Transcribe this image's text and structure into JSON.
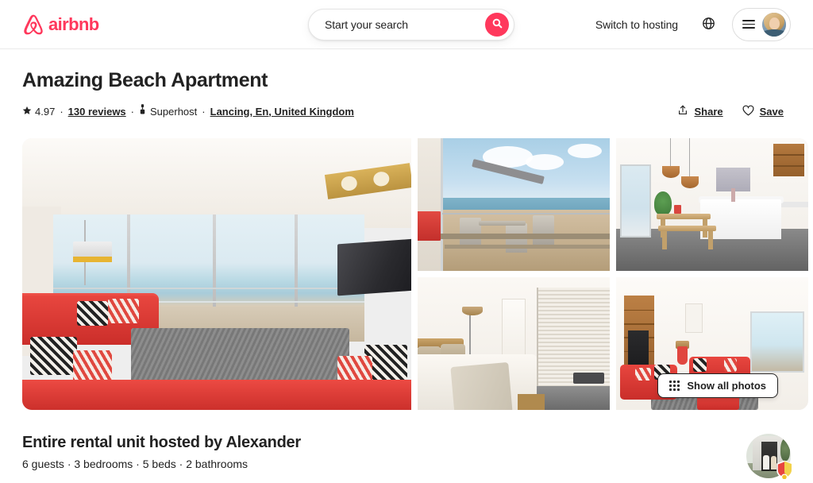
{
  "header": {
    "logo_text": "airbnb",
    "logo_icon": "airbnb-bird-logo",
    "search_placeholder": "Start your search",
    "search_icon": "search-icon",
    "switch_to_hosting": "Switch to hosting",
    "globe_icon": "globe-icon",
    "menu_icon": "hamburger-menu-icon",
    "avatar_icon": "user-avatar"
  },
  "listing": {
    "title": "Amazing Beach Apartment",
    "star_icon": "star-icon",
    "rating": "4.97",
    "separator": "·",
    "reviews": "130 reviews",
    "superhost_icon": "superhost-badge-icon",
    "superhost": "Superhost",
    "location": "Lancing, En, United Kingdom",
    "share_icon": "share-upload-icon",
    "share_label": "Share",
    "save_icon": "heart-icon",
    "save_label": "Save"
  },
  "gallery": {
    "show_all_label": "Show all photos",
    "show_all_icon": "grid-dots-icon",
    "photos": [
      {
        "name": "living-room-sea-view"
      },
      {
        "name": "balcony-beach-view"
      },
      {
        "name": "dining-kitchen"
      },
      {
        "name": "bedroom"
      },
      {
        "name": "lounge-red-sofas"
      }
    ]
  },
  "host_section": {
    "title": "Entire rental unit hosted by Alexander",
    "details": "6 guests · 3 bedrooms · 5 beds · 2 bathrooms",
    "avatar_icon": "host-avatar",
    "superhost_badge_icon": "superhost-shield-badge"
  },
  "colors": {
    "brand": "#ff385c",
    "text": "#222222",
    "border": "#ebebeb"
  }
}
